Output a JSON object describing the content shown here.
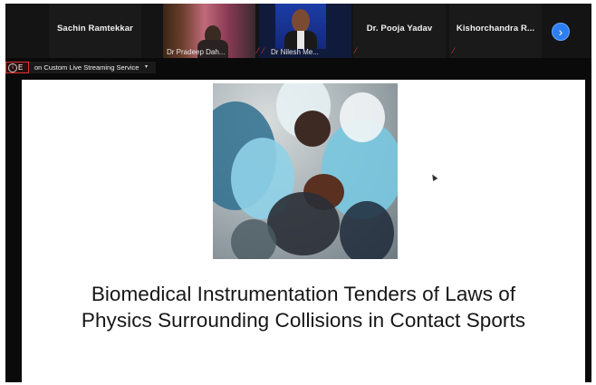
{
  "app": "Zoom meeting",
  "participants": [
    {
      "id": "sachin",
      "name": "Sachin Ramtekkar",
      "video": false,
      "muted": false
    },
    {
      "id": "pradeep",
      "name": "Dr Pradeep Dah...",
      "video": true,
      "muted": true
    },
    {
      "id": "nilesh",
      "name": "Dr Nilesh Me...",
      "video": true,
      "muted": true
    },
    {
      "id": "pooja",
      "name": "Dr. Pooja Yadav",
      "video": false,
      "muted": true
    },
    {
      "id": "kishor",
      "name": "Kishorchandra R...",
      "video": false,
      "muted": true
    }
  ],
  "nav": {
    "next_glyph": "›"
  },
  "recording": {
    "info_glyph": "i",
    "letter": "E"
  },
  "live": {
    "label": "on Custom Live Streaming Service",
    "caret": "▾"
  },
  "slide": {
    "title_line1": "Biomedical Instrumentation Tenders of Laws of",
    "title_line2": "Physics Surrounding Collisions in Contact Sports",
    "photo_alt": "Football players colliding"
  },
  "colors": {
    "accent": "#2d7ff0",
    "muted_mic": "#e0303a",
    "rec_border": "#e03030"
  }
}
